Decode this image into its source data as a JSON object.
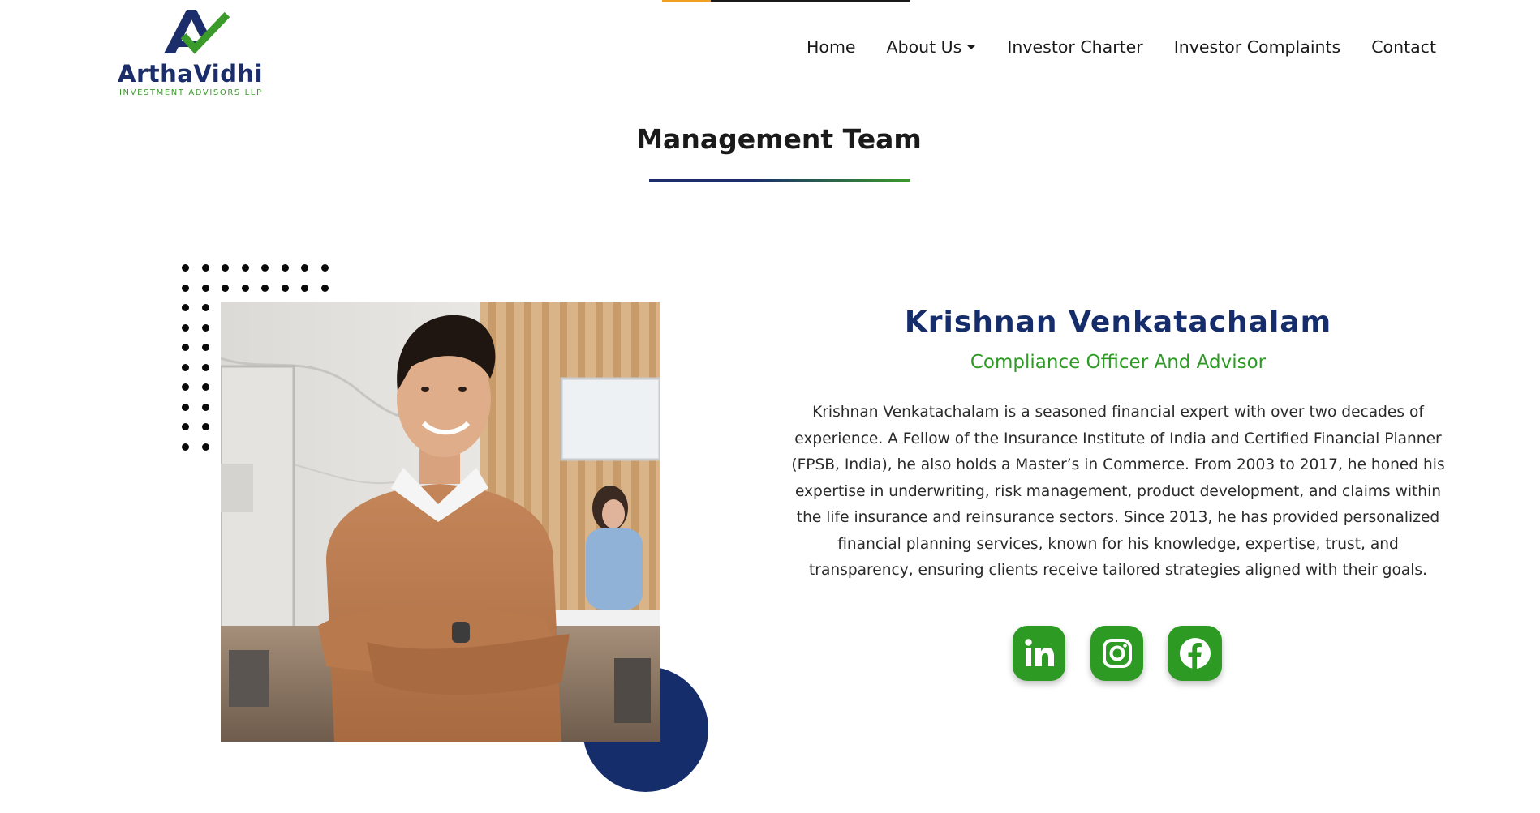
{
  "header": {
    "logo": {
      "name": "ArthaVidhi",
      "tagline": "INVESTMENT ADVISORS LLP"
    },
    "nav": [
      {
        "label": "Home"
      },
      {
        "label": "About Us",
        "has_dropdown": true
      },
      {
        "label": "Investor Charter"
      },
      {
        "label": "Investor Complaints"
      },
      {
        "label": "Contact"
      }
    ]
  },
  "section": {
    "title": "Management Team"
  },
  "profile": {
    "name": "Krishnan Venkatachalam",
    "role": "Compliance Officer And Advisor",
    "bio": "Krishnan Venkatachalam is a seasoned financial expert with over two decades of experience. A Fellow of the Insurance Institute of India and Certified Financial Planner (FPSB, India), he also holds a Master’s in Commerce. From 2003 to 2017, he honed his expertise in underwriting, risk management, product development, and claims within the life insurance and reinsurance sectors. Since 2013, he has provided personalized financial planning services, known for his knowledge, expertise, trust, and transparency, ensuring clients receive tailored strategies aligned with their goals.",
    "socials": [
      {
        "icon": "linkedin-icon"
      },
      {
        "icon": "instagram-icon"
      },
      {
        "icon": "facebook-icon"
      }
    ]
  },
  "colors": {
    "brand_navy": "#162d6b",
    "brand_green": "#2d9a24",
    "accent_orange": "#f0a020"
  }
}
